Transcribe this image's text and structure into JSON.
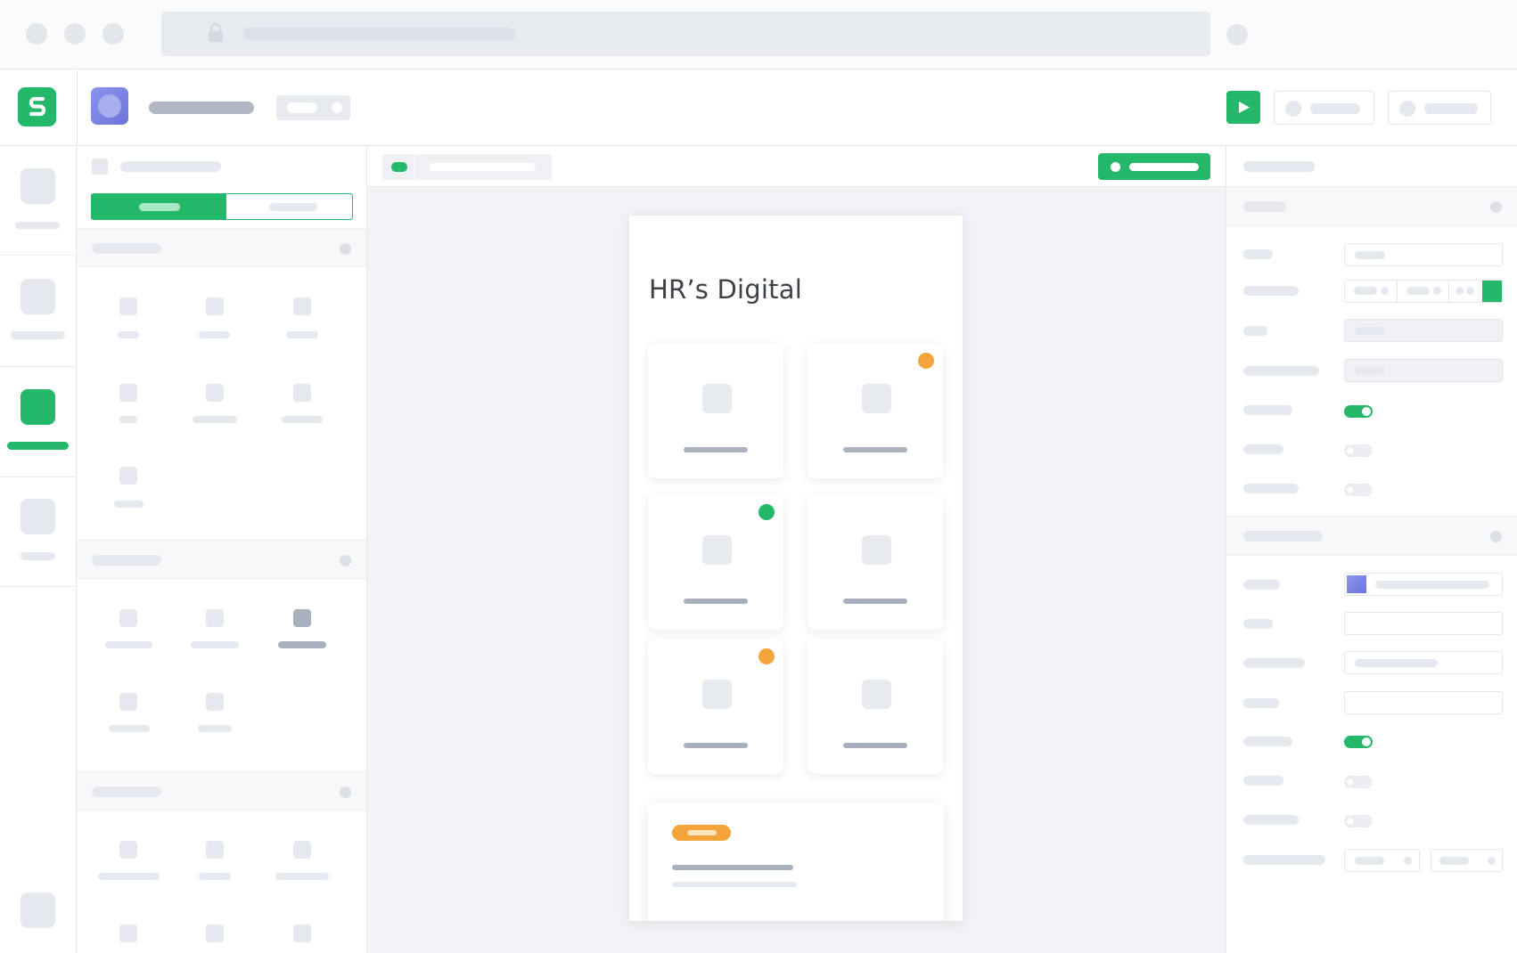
{
  "app": {
    "screen_title": "HR’s Digital",
    "accent_color": "#24b86a",
    "warning_color": "#f3a43b",
    "logo_icon": "stacker-logo-icon"
  },
  "home_tiles": [
    {
      "badge": "none"
    },
    {
      "badge": "orange"
    },
    {
      "badge": "green"
    },
    {
      "badge": "none"
    },
    {
      "badge": "orange"
    },
    {
      "badge": "none"
    }
  ],
  "properties": {
    "toggles": [
      true,
      false,
      false,
      true,
      false,
      false
    ]
  }
}
